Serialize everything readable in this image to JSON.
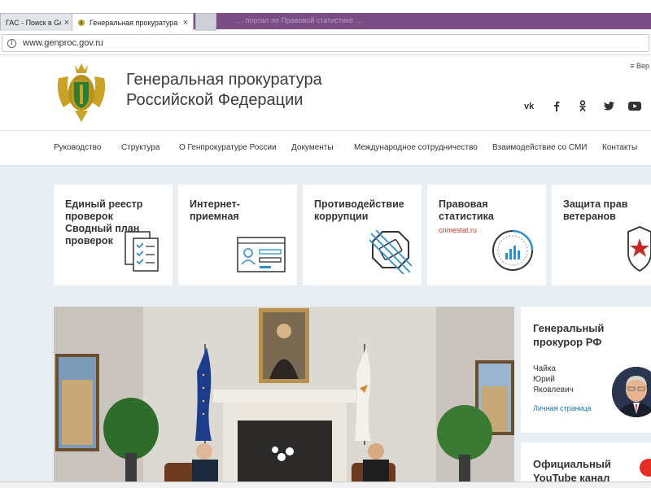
{
  "browser": {
    "tabs": [
      {
        "title": "ГАС - Поиск в Googl",
        "active": false
      },
      {
        "title": "Генеральная прокуратура",
        "active": true
      },
      {
        "title": "",
        "active": false
      }
    ],
    "faded_url": "… портал по Правовой статистике …",
    "address": "www.genproc.gov.ru",
    "close_glyph": "×"
  },
  "header": {
    "title_line1": "Генеральная прокуратура",
    "title_line2": "Российской Федерации",
    "version_link": "≡ Вер",
    "socials": [
      {
        "icon": "vk-icon",
        "glyph": "vk"
      },
      {
        "icon": "facebook-icon",
        "glyph": "f"
      },
      {
        "icon": "odnoklassniki-icon",
        "glyph": "ok"
      },
      {
        "icon": "twitter-icon",
        "glyph": "t"
      },
      {
        "icon": "youtube-icon",
        "glyph": "yt"
      }
    ]
  },
  "nav": {
    "items": [
      "Руководство",
      "Структура",
      "О Генпрокуратуре России",
      "Документы",
      "Международное сотрудничество",
      "Взаимодействие со СМИ",
      "Контакты"
    ]
  },
  "cards": [
    {
      "title_lines": [
        "Единый реестр",
        "проверок",
        "Сводный план",
        "проверок"
      ],
      "sub": ""
    },
    {
      "title_lines": [
        "Интернет-",
        "приемная"
      ],
      "sub": ""
    },
    {
      "title_lines": [
        "Противодействие",
        "коррупции"
      ],
      "sub": ""
    },
    {
      "title_lines": [
        "Правовая",
        "статистика"
      ],
      "sub": "crimestat.ru"
    },
    {
      "title_lines": [
        "Защита прав",
        "ветеранов"
      ],
      "sub": ""
    }
  ],
  "prosecutor": {
    "heading_line1": "Генеральный",
    "heading_line2": "прокурор РФ",
    "name_line1": "Чайка",
    "name_line2": "Юрий",
    "name_line3": "Яковлевич",
    "link": "Личная страница"
  },
  "youtube": {
    "title_line1": "Официальный",
    "title_line2": "YouTube канал"
  },
  "colors": {
    "accent_red": "#c0392b",
    "link_blue": "#1a7bb9",
    "content_bg": "#e8eef1",
    "tab_band": "#7b4d86"
  }
}
